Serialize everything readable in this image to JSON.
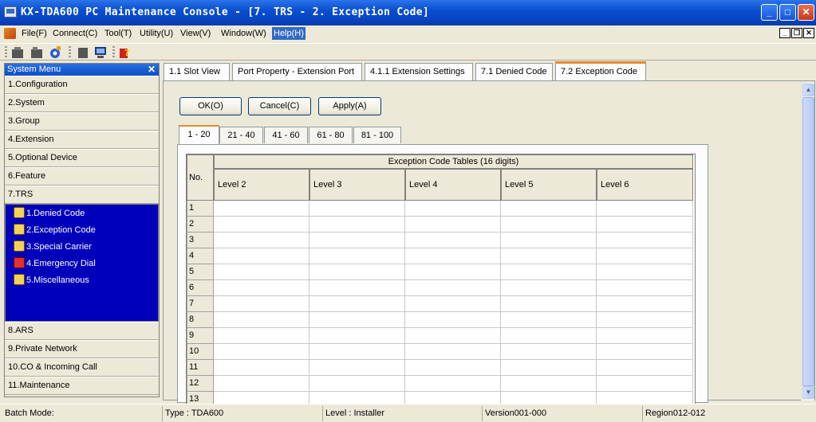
{
  "window": {
    "title": "KX-TDA600 PC Maintenance Console - [7. TRS - 2. Exception Code]",
    "buttons": {
      "minimize": "_",
      "maximize": "□",
      "close": "✕"
    }
  },
  "menu": [
    {
      "label": "File(F)"
    },
    {
      "label": "Connect(C)"
    },
    {
      "label": "Tool(T)"
    },
    {
      "label": "Utility(U)"
    },
    {
      "label": "View(V)"
    },
    {
      "label": "Window(W)"
    },
    {
      "label": "Help(H)"
    }
  ],
  "mdi_buttons": {
    "minimize": "_",
    "restore": "❐",
    "close": "✕"
  },
  "sidebar": {
    "title": "System Menu",
    "close": "✕",
    "items_top": [
      {
        "label": "1.Configuration"
      },
      {
        "label": "2.System"
      },
      {
        "label": "3.Group"
      },
      {
        "label": "4.Extension"
      },
      {
        "label": "5.Optional Device"
      },
      {
        "label": "6.Feature"
      },
      {
        "label": "7.TRS"
      }
    ],
    "trs_sub": [
      {
        "label": "1.Denied Code"
      },
      {
        "label": "2.Exception Code"
      },
      {
        "label": "3.Special Carrier"
      },
      {
        "label": "4.Emergency Dial"
      },
      {
        "label": "5.Miscellaneous"
      }
    ],
    "items_bottom": [
      {
        "label": "8.ARS"
      },
      {
        "label": "9.Private Network"
      },
      {
        "label": "10.CO & Incoming Call"
      },
      {
        "label": "11.Maintenance"
      }
    ]
  },
  "tabs": [
    {
      "label": "1.1 Slot View"
    },
    {
      "label": "Port Property - Extension Port"
    },
    {
      "label": "4.1.1 Extension Settings"
    },
    {
      "label": "7.1 Denied Code"
    },
    {
      "label": "7.2 Exception Code"
    }
  ],
  "actions": {
    "ok": "OK(O)",
    "cancel": "Cancel(C)",
    "apply": "Apply(A)"
  },
  "range_tabs": [
    "1 - 20",
    "21 - 40",
    "41 - 60",
    "61 - 80",
    "81 - 100"
  ],
  "table": {
    "no_header": "No.",
    "group_header": "Exception Code Tables (16 digits)",
    "levels": [
      "Level 2",
      "Level 3",
      "Level 4",
      "Level 5",
      "Level 6"
    ],
    "rows": [
      "1",
      "2",
      "3",
      "4",
      "5",
      "6",
      "7",
      "8",
      "9",
      "10",
      "11",
      "12",
      "13"
    ]
  },
  "status": {
    "batch_mode": "Batch Mode:",
    "type": "Type : TDA600",
    "level": "Level : Installer",
    "version": "Version001-000",
    "region": "Region012-012"
  },
  "colors": {
    "title_blue": "#0a4fd0",
    "submenu_blue": "#0000bb",
    "tab_accent": "#e68b2c"
  }
}
